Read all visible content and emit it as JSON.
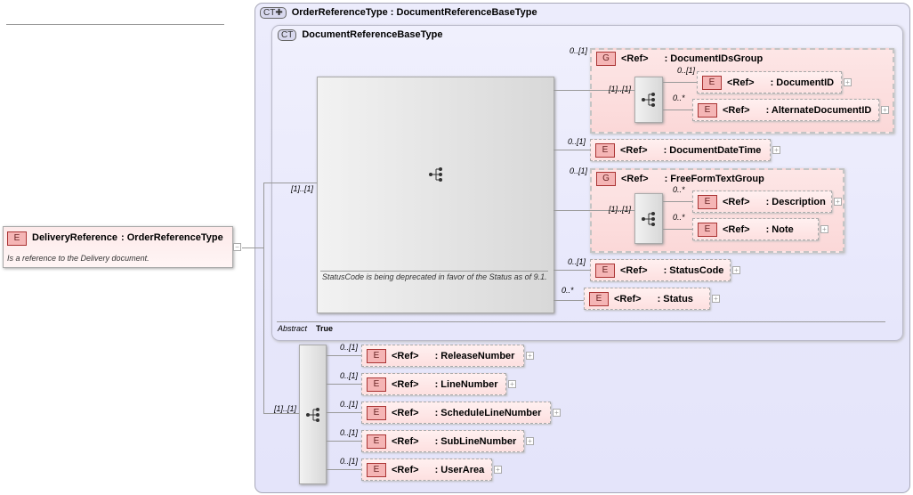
{
  "root": {
    "badge": "E",
    "name": "DeliveryReference",
    "type": ": OrderReferenceType",
    "doc": "Is a reference to the Delivery document.",
    "collapse": "−"
  },
  "outer_type": {
    "badge": "CT✚",
    "title": "OrderReferenceType : DocumentReferenceBaseType"
  },
  "inner_type": {
    "badge": "CT",
    "title": "DocumentReferenceBaseType",
    "abstract_label": "Abstract",
    "abstract_value": "True"
  },
  "main_sequence": {
    "cardinality": "[1]..[1]",
    "doc": "StatusCode is being deprecated in favor of the Status as of 9.1."
  },
  "groups": [
    {
      "badge": "G",
      "ref": "<Ref>",
      "name": ": DocumentIDsGroup",
      "cardinality": "0..[1]",
      "seq_cardinality": "[1]..[1]",
      "children": [
        {
          "badge": "E",
          "ref": "<Ref>",
          "name": ": DocumentID",
          "cardinality": "0..[1]"
        },
        {
          "badge": "E",
          "ref": "<Ref>",
          "name": ": AlternateDocumentID",
          "cardinality": "0..*"
        }
      ]
    },
    {
      "badge": "G",
      "ref": "<Ref>",
      "name": ": FreeFormTextGroup",
      "cardinality": "0..[1]",
      "seq_cardinality": "[1]..[1]",
      "children": [
        {
          "badge": "E",
          "ref": "<Ref>",
          "name": ": Description",
          "cardinality": "0..*"
        },
        {
          "badge": "E",
          "ref": "<Ref>",
          "name": ": Note",
          "cardinality": "0..*"
        }
      ]
    }
  ],
  "elements": [
    {
      "badge": "E",
      "ref": "<Ref>",
      "name": ": DocumentDateTime",
      "cardinality": "0..[1]"
    },
    {
      "badge": "E",
      "ref": "<Ref>",
      "name": ": StatusCode",
      "cardinality": "0..[1]"
    },
    {
      "badge": "E",
      "ref": "<Ref>",
      "name": ": Status",
      "cardinality": "0..*"
    }
  ],
  "bottom_sequence": {
    "cardinality": "[1]..[1]",
    "items": [
      {
        "badge": "E",
        "ref": "<Ref>",
        "name": ": ReleaseNumber",
        "cardinality": "0..[1]"
      },
      {
        "badge": "E",
        "ref": "<Ref>",
        "name": ": LineNumber",
        "cardinality": "0..[1]"
      },
      {
        "badge": "E",
        "ref": "<Ref>",
        "name": ": ScheduleLineNumber",
        "cardinality": "0..[1]"
      },
      {
        "badge": "E",
        "ref": "<Ref>",
        "name": ": SubLineNumber",
        "cardinality": "0..[1]"
      },
      {
        "badge": "E",
        "ref": "<Ref>",
        "name": ": UserArea",
        "cardinality": "0..[1]"
      }
    ]
  },
  "expand_symbol": "+",
  "sequence_icon": "sequence-compositor-icon"
}
